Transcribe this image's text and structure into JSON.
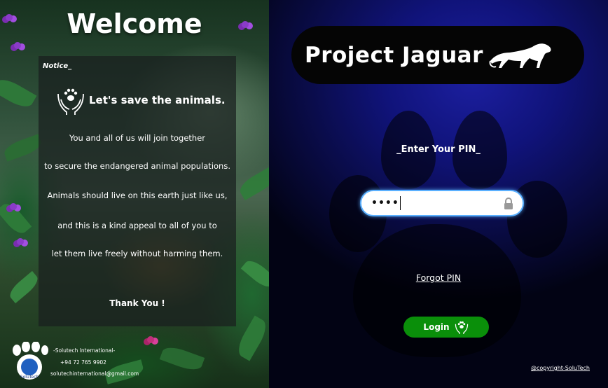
{
  "left": {
    "welcome": "Welcome",
    "notice_label": "Notice_",
    "save_heading": "Let's save the animals.",
    "lines": [
      "You and all of us will join together",
      "to secure the endangered animal populations.",
      "Animals should live on this earth just like us,",
      "and this is a kind appeal to all of you to",
      "let them live freely without harming them."
    ],
    "thanks": "Thank You !",
    "company": "-Solutech International-",
    "phone": "+94 72 765 9902",
    "email": "solutechinternational@gmail.com",
    "logo_text": "SoluTech"
  },
  "right": {
    "title": "Project Jaguar",
    "pin_label": "_Enter Your PIN_",
    "pin_value": "••••",
    "forgot": "Forgot PIN",
    "login": "Login",
    "copyright": "@copyright-SoluTech"
  },
  "colors": {
    "accent_blue": "#1c1fa0",
    "login_green": "#0a8f0a",
    "input_border": "#5ab0ff"
  }
}
